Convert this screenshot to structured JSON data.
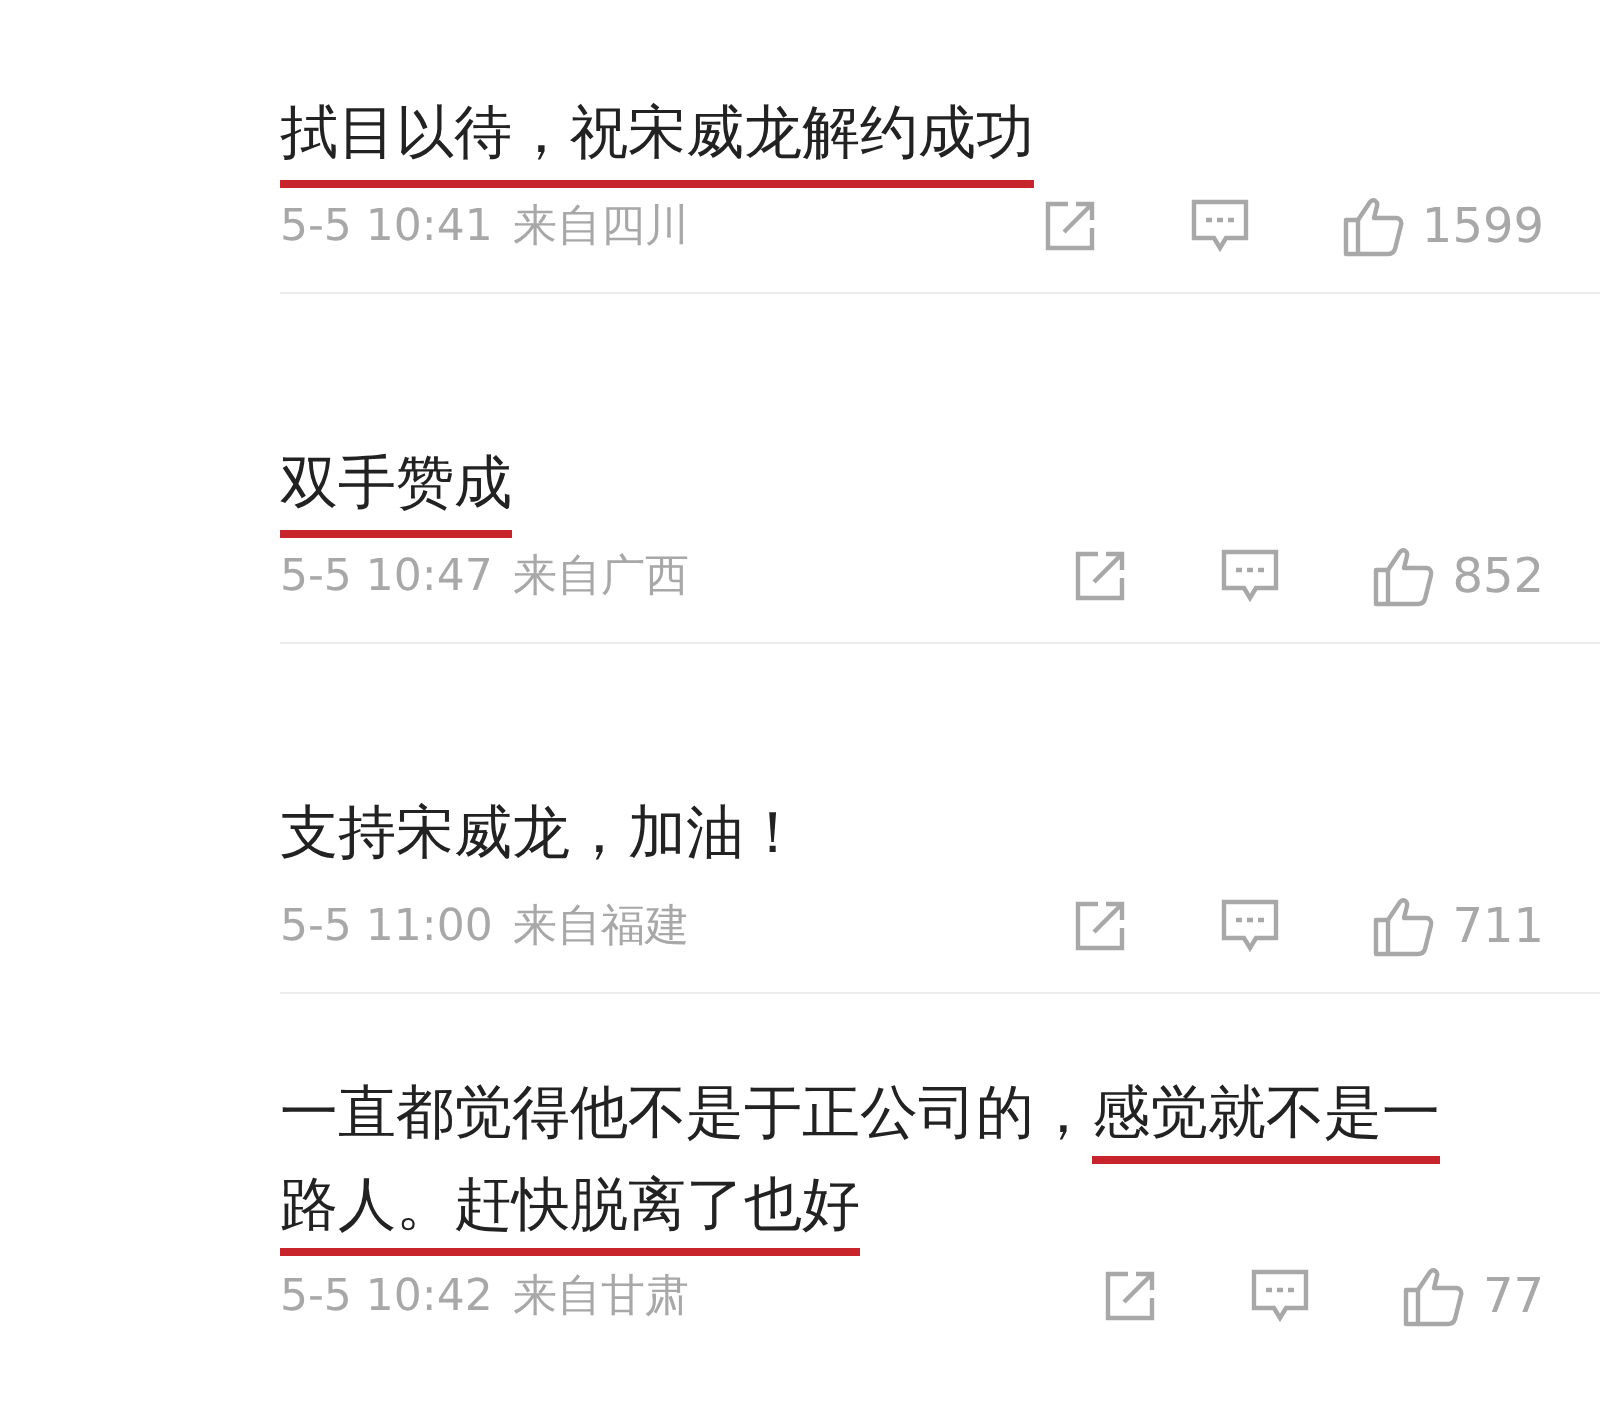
{
  "comments": [
    {
      "text": "拭目以待，祝宋威龙解约成功",
      "underlined": true,
      "time": "5-5 10:41",
      "location": "来自四川",
      "likes": "1599"
    },
    {
      "text": "双手赞成",
      "underlined": true,
      "time": "5-5 10:47",
      "location": "来自广西",
      "likes": "852"
    },
    {
      "text": "支持宋威龙，加油！",
      "underlined": false,
      "time": "5-5 11:00",
      "location": "来自福建",
      "likes": "711"
    },
    {
      "text": "一直都觉得他不是于正公司的，*感觉就不是一路人。赶快脱离了也好*",
      "underlined": false,
      "time": "5-5 10:42",
      "location": "来自甘肃",
      "likes": "77"
    }
  ]
}
